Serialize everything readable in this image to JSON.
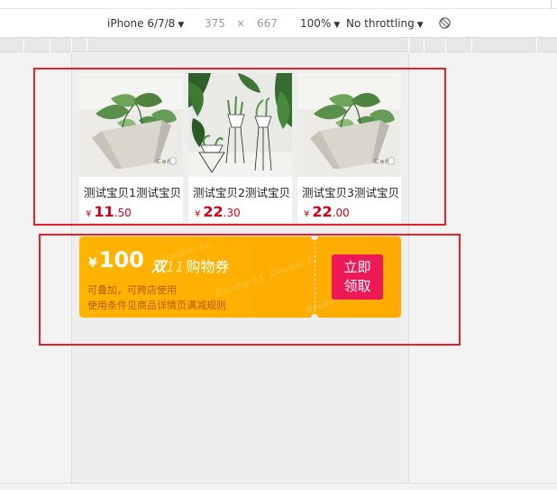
{
  "devtools": {
    "device": "iPhone 6/7/8",
    "width": "375",
    "times": "×",
    "height": "667",
    "zoom": "100%",
    "throttling": "No throttling",
    "caret": "▼"
  },
  "products": [
    {
      "title": "测试宝贝1测试宝贝",
      "currency": "¥",
      "price_int": "11",
      "price_dec": ".50",
      "image": "plant-pot-product-photo"
    },
    {
      "title": "测试宝贝2测试宝贝",
      "currency": "¥",
      "price_int": "22",
      "price_dec": ".30",
      "image": "plants-on-wire-stands-photo"
    },
    {
      "title": "测试宝贝3测试宝贝",
      "currency": "¥",
      "price_int": "22",
      "price_dec": ".00",
      "image": "plant-pot-product-photo"
    }
  ],
  "coupon": {
    "currency": "¥",
    "amount": "100",
    "brand": "双",
    "brand_sub": "11",
    "name": "购物券",
    "note1": "可叠加，可跨店使用",
    "note2": "使用条件见商品详情页满减规则",
    "claim_line1": "立即",
    "claim_line2": "领取",
    "watermark": "Double 11"
  },
  "colors": {
    "price_red": "#d0021b",
    "coupon_orange": "#ffb400",
    "claim_pink": "#ee1a58",
    "annotation_red": "#e8202a"
  }
}
